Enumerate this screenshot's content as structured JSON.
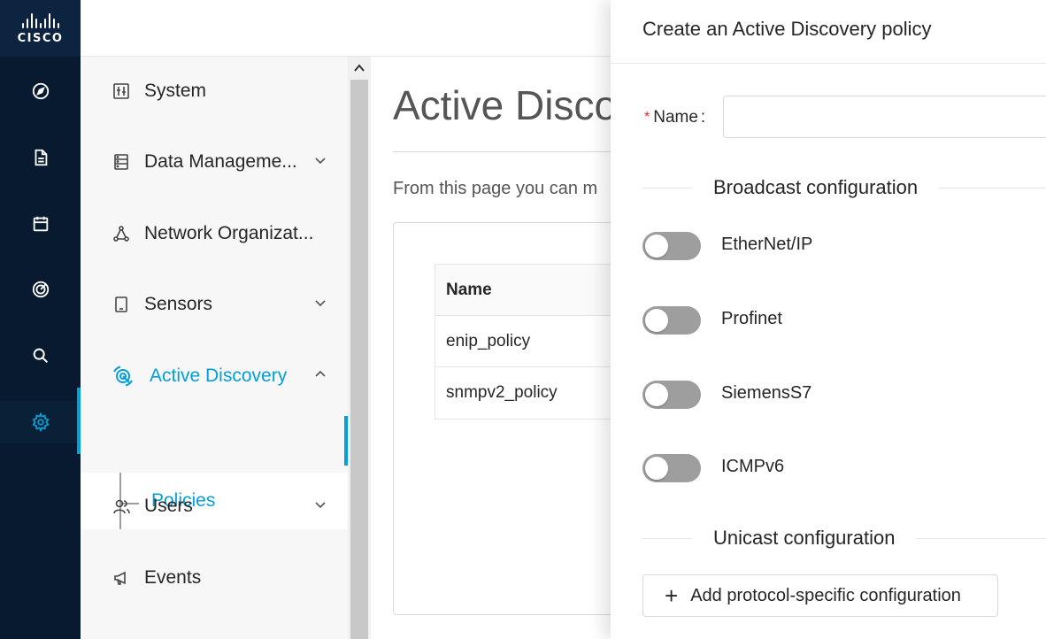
{
  "brand": {
    "logo_text": "CISCO"
  },
  "rail": {
    "icons": [
      "compass-icon",
      "document-icon",
      "calendar-icon",
      "target-icon",
      "search-icon",
      "gear-icon"
    ],
    "active_index": 5
  },
  "sidebar": {
    "items": [
      {
        "label": "System",
        "icon": "sliders-icon"
      },
      {
        "label": "Data Manageme...",
        "icon": "database-icon"
      },
      {
        "label": "Network Organizat...",
        "icon": "network-icon"
      },
      {
        "label": "Sensors",
        "icon": "sensor-icon"
      },
      {
        "label": "Active Discovery",
        "icon": "active-discovery-icon"
      },
      {
        "label": "Users",
        "icon": "users-icon"
      },
      {
        "label": "Events",
        "icon": "megaphone-icon"
      }
    ],
    "sub_item": {
      "label": "Policies"
    }
  },
  "main": {
    "title": "Active Discove",
    "description": "From this page you can m",
    "table": {
      "header": "Name",
      "rows": [
        "enip_policy",
        "snmpv2_policy"
      ]
    }
  },
  "drawer": {
    "title": "Create an Active Discovery policy",
    "name_field": {
      "required_mark": "*",
      "label": "Name",
      "colon": ":",
      "value": "",
      "placeholder": ""
    },
    "broadcast_title": "Broadcast configuration",
    "toggles": [
      {
        "label": "EtherNet/IP",
        "on": false
      },
      {
        "label": "Profinet",
        "on": false
      },
      {
        "label": "SiemensS7",
        "on": false
      },
      {
        "label": "ICMPv6",
        "on": false
      }
    ],
    "unicast_title": "Unicast configuration",
    "add_button": {
      "icon": "plus-icon",
      "label": "Add protocol-specific configuration"
    }
  },
  "colors": {
    "accent": "#049fd9",
    "rail_bg": "#071a2f",
    "toggle_off": "#9e9e9e",
    "required": "#f5222d"
  }
}
